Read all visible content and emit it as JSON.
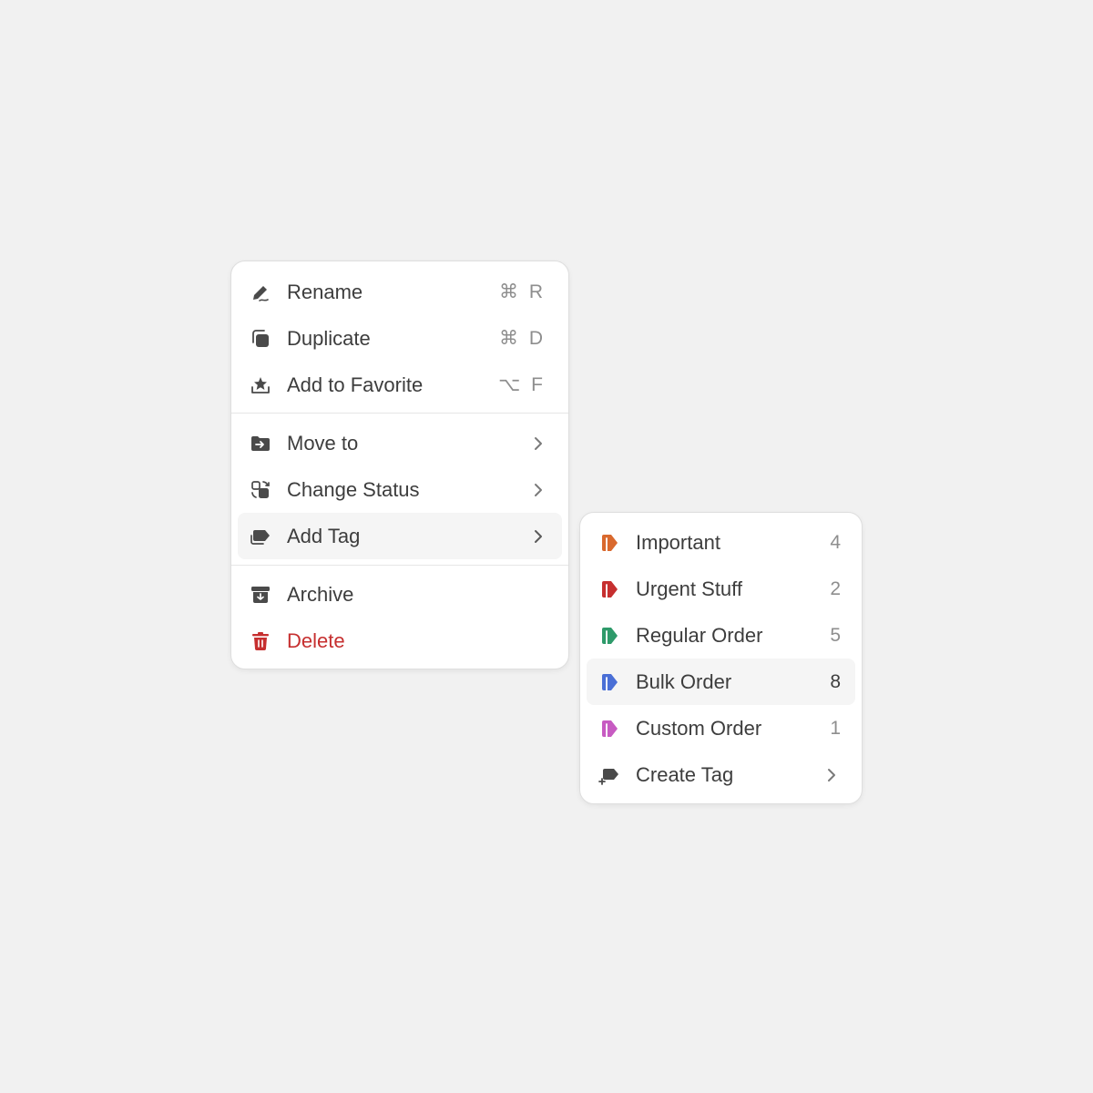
{
  "main_menu": {
    "items": [
      {
        "label": "Rename",
        "shortcut": "⌘ R",
        "icon": "pen-icon"
      },
      {
        "label": "Duplicate",
        "shortcut": "⌘ D",
        "icon": "duplicate-icon"
      },
      {
        "label": "Add to Favorite",
        "shortcut": "⌥ F",
        "icon": "star-tray-icon"
      },
      {
        "label": "Move to",
        "icon": "folder-move-icon"
      },
      {
        "label": "Change Status",
        "icon": "status-change-icon"
      },
      {
        "label": "Add Tag",
        "icon": "tags-icon",
        "active": true
      },
      {
        "label": "Archive",
        "icon": "archive-icon"
      },
      {
        "label": "Delete",
        "icon": "trash-icon",
        "color": "#c62f2f"
      }
    ]
  },
  "tag_menu": {
    "items": [
      {
        "label": "Important",
        "count": "4",
        "color": "#d9692e",
        "icon": "tag-icon"
      },
      {
        "label": "Urgent Stuff",
        "count": "2",
        "color": "#c62f2f",
        "icon": "tag-icon"
      },
      {
        "label": "Regular Order",
        "count": "5",
        "color": "#2e9a6a",
        "icon": "tag-icon"
      },
      {
        "label": "Bulk Order",
        "count": "8",
        "color": "#4a6fd6",
        "icon": "tag-icon",
        "active": true
      },
      {
        "label": "Custom Order",
        "count": "1",
        "color": "#c75bc2",
        "icon": "tag-icon"
      },
      {
        "label": "Create Tag",
        "icon": "tag-plus-icon"
      }
    ]
  },
  "colors": {
    "background": "#f1f1f1",
    "icon_gray": "#4a4a4a",
    "danger": "#c62f2f",
    "active_row": "#f5f5f5"
  }
}
